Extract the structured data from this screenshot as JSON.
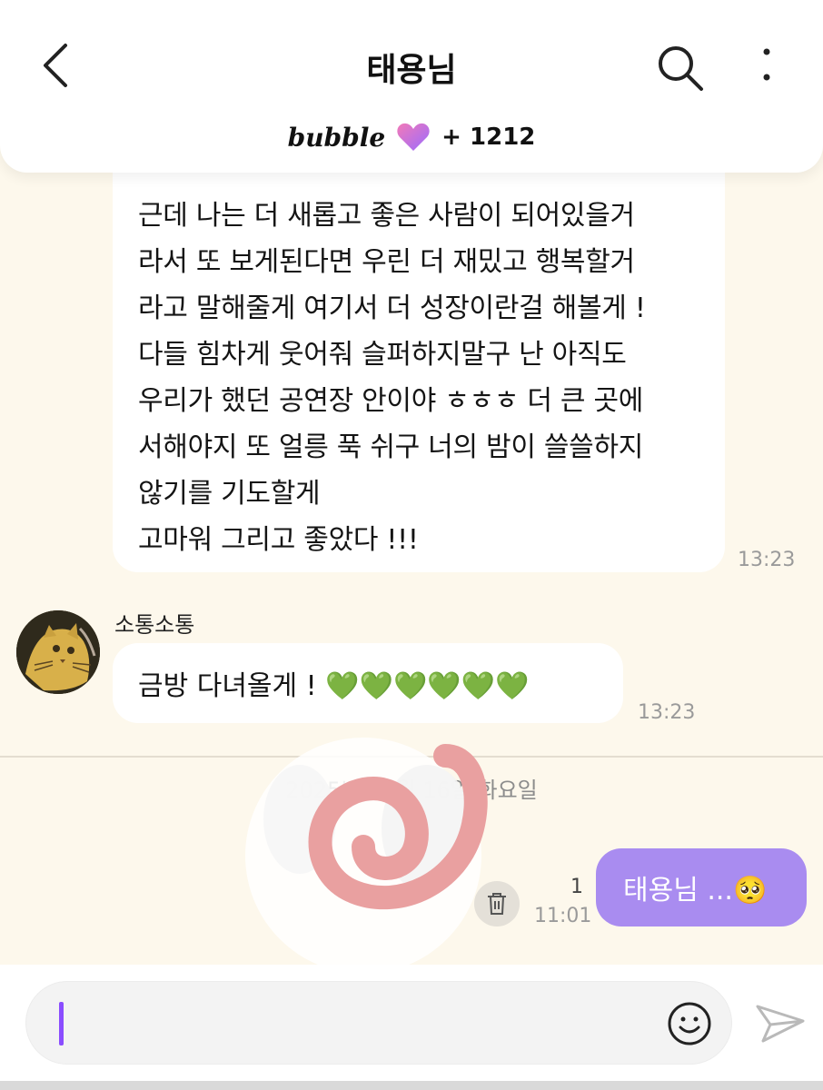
{
  "header": {
    "title": "태용님",
    "bubble_logo": "bubble",
    "bubble_count": "+ 1212",
    "icons": [
      "chevron-left-icon",
      "search-icon",
      "more-vertical-icon",
      "heart-icon"
    ]
  },
  "messages": {
    "long": {
      "lines": [
        "근데 나는 더 새롭고 좋은 사람이 되어있을거",
        "라서 또 보게된다면 우린 더 재밌고 행복할거",
        "라고 말해줄게 여기서 더 성장이란걸 해볼게 !",
        "다들 힘차게 웃어줘 슬퍼하지말구 난 아직도",
        "우리가 했던 공연장 안이야 ㅎㅎㅎ 더 큰 곳에",
        "서해야지 또 얼릉 푹 쉬구 너의 밤이 쓸쓸하지",
        "않기를 기도할게",
        "고마워 그리고 좋았다 !!!"
      ],
      "time": "13:23"
    },
    "short": {
      "sender": "소통소통",
      "text": "금방 다녀올게 ! 💚💚💚💚💚💚",
      "time": "13:23"
    },
    "date_separator": "2025년 12월 16일 화요일",
    "mine": {
      "text": "태용님 ...🥺",
      "read_count": "1",
      "time": "11:01"
    }
  },
  "input": {
    "placeholder": "",
    "icons": [
      "smile-icon",
      "send-icon"
    ]
  },
  "colors": {
    "background": "#fdf8ec",
    "my_bubble": "#a98cf0",
    "caret": "#8a4dff",
    "heart_pink": "#f27ab8",
    "heart_purple": "#9a6bff"
  }
}
